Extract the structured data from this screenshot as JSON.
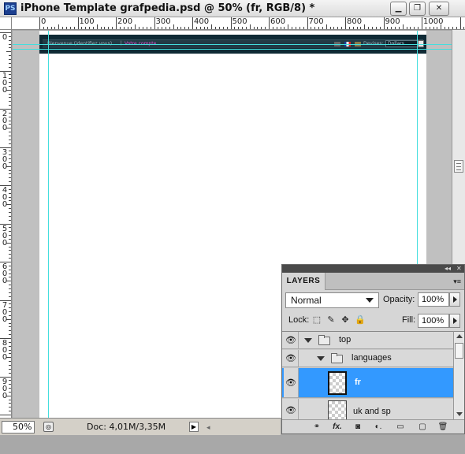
{
  "window": {
    "app_icon": "PS",
    "title": "iPhone Template grafpedia.psd @ 50% (fr, RGB/8) *",
    "minimize": "▁",
    "restore": "❐",
    "close": "✕"
  },
  "ruler": {
    "top_labels": [
      "0",
      "100",
      "200",
      "300",
      "400",
      "500",
      "600",
      "700",
      "800",
      "900",
      "1000"
    ],
    "left_labels": [
      "0",
      "100",
      "200",
      "300",
      "400",
      "500",
      "600",
      "700",
      "800",
      "900"
    ]
  },
  "document": {
    "welcome_text": "Bienvenue (identifiez vous)",
    "separator": "|",
    "account_text": "Votre compte",
    "devises_label": "Devises:",
    "currency_value": "Dollars"
  },
  "status": {
    "zoom": "50%",
    "doc_size": "Doc: 4,01M/3,35M"
  },
  "layers_panel": {
    "tab_label": "LAYERS",
    "collapse_icon": "◂◂",
    "close_icon": "✕",
    "menu_icon": "▾≡",
    "blend_mode": "Normal",
    "opacity_label": "Opacity:",
    "opacity_value": "100%",
    "lock_label": "Lock:",
    "fill_label": "Fill:",
    "fill_value": "100%",
    "layers": [
      {
        "name": "top",
        "type": "group",
        "expanded": true,
        "visible": true,
        "selected": false
      },
      {
        "name": "languages",
        "type": "group",
        "expanded": true,
        "visible": true,
        "selected": false
      },
      {
        "name": "fr",
        "type": "layer",
        "visible": true,
        "selected": true
      },
      {
        "name": "uk and sp",
        "type": "layer",
        "visible": true,
        "selected": false
      }
    ],
    "footer_icons": [
      "link-icon",
      "fx-icon",
      "mask-icon",
      "adjustment-icon",
      "group-icon",
      "new-layer-icon",
      "trash-icon"
    ],
    "footer_glyphs": [
      "⚭",
      "fx.",
      "◙",
      "◐.",
      "▭",
      "▢",
      "🗑"
    ]
  },
  "colors": {
    "selected_layer": "#3399ff",
    "guide": "#43dede",
    "header_bar": "#0f2a35",
    "account_link": "#e44fd0"
  }
}
